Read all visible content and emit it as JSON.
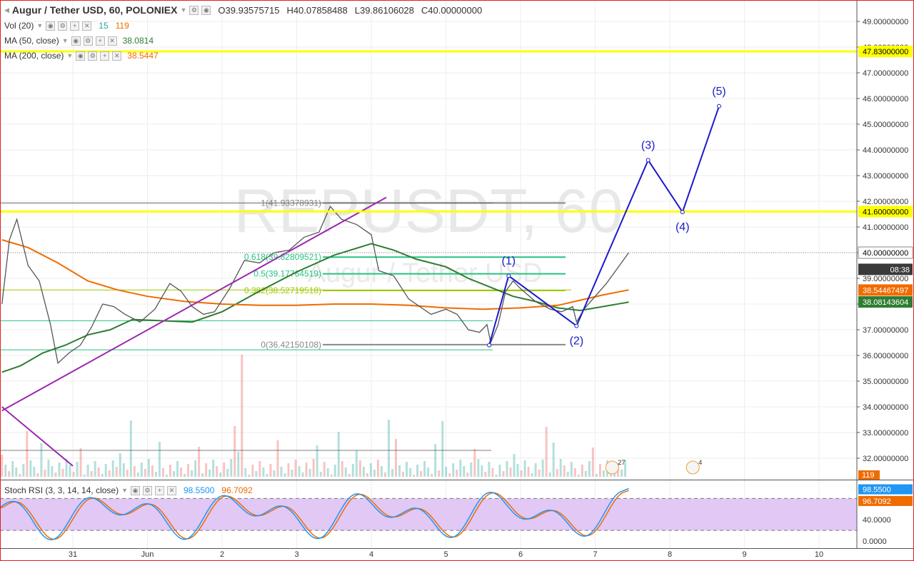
{
  "header": {
    "symbol_title": "Augur / Tether USD, 60, POLONIEX",
    "ohlc": {
      "open": "O39.93575715",
      "high": "H40.07858488",
      "low": "L39.86106028",
      "close": "C40.00000000"
    },
    "indicators": [
      {
        "label": "Vol (20)",
        "values": [
          "15",
          "119"
        ],
        "colors": [
          "#26a69a",
          "#ef6c00"
        ]
      },
      {
        "label": "MA (50, close)",
        "values": [
          "38.0814"
        ],
        "colors": [
          "#2e7d32"
        ]
      },
      {
        "label": "MA (200, close)",
        "values": [
          "38.5447"
        ],
        "colors": [
          "#ef6c00"
        ]
      }
    ],
    "watermark_symbol": "REPUSDT, 60",
    "watermark_name": "Augur / Tether USD"
  },
  "colors": {
    "up": "#26a69a",
    "down": "#ef5350",
    "ma50": "#2e7d32",
    "ma200": "#ef6c00",
    "yellow_line": "#ffff00",
    "wave": "#1a1acc",
    "trend": "#9c27b0",
    "fib_green": "#26c281",
    "fib_olive": "#a0c800",
    "fib_gray": "#888888",
    "rsi_fill": "#e1c8f5",
    "rsi_k": "#2196f3",
    "rsi_d": "#ef6c00"
  },
  "chart_data": {
    "type": "line",
    "price_axis": {
      "range": [
        31.5,
        49.5
      ],
      "ticks": [
        "49.00000000",
        "48.00000000",
        "47.00000000",
        "46.00000000",
        "45.00000000",
        "44.00000000",
        "43.00000000",
        "42.00000000",
        "41.00000000",
        "40.00000000",
        "39.00000000",
        "38.00000000",
        "37.00000000",
        "36.00000000",
        "35.00000000",
        "34.00000000",
        "33.00000000",
        "32.00000000"
      ],
      "tick_values": [
        49,
        48,
        47,
        46,
        45,
        44,
        43,
        42,
        41,
        40,
        39,
        38,
        37,
        36,
        35,
        34,
        33,
        32
      ]
    },
    "price_labels": [
      {
        "value": 47.83,
        "text": "47.83000000",
        "style": "yellow"
      },
      {
        "value": 41.6,
        "text": "41.60000000",
        "style": "yellow"
      },
      {
        "value": 40.0,
        "text": "40.00000000",
        "style": "white"
      },
      {
        "value": 39.35,
        "text": "08:38",
        "style": "dark"
      },
      {
        "value": 38.5447,
        "text": "38.54467497",
        "style": "orange"
      },
      {
        "value": 38.0814,
        "text": "38.08143604",
        "style": "green"
      }
    ],
    "volume_label": "119",
    "x_axis": {
      "labels": [
        "31",
        "Jun",
        "2",
        "3",
        "4",
        "5",
        "6",
        "7",
        "8",
        "9",
        "10"
      ],
      "positions": [
        0.0,
        1.0,
        2.0,
        3.0,
        4.0,
        5.0,
        6.0,
        7.0,
        8.0,
        9.0,
        10.0
      ]
    },
    "horizontal_lines": [
      {
        "value": 47.83,
        "color": "yellow"
      },
      {
        "value": 41.6,
        "color": "yellow"
      }
    ],
    "fibonacci": [
      {
        "level": "1",
        "price": 41.93378931,
        "label": "1(41.93378931)"
      },
      {
        "level": "0.618",
        "price": 39.82809521,
        "label": "0.618(39.82809521)"
      },
      {
        "level": "0.5",
        "price": 39.17764519,
        "label": "0.5(39.17764519)"
      },
      {
        "level": "0.382",
        "price": 38.52719518,
        "label": "0.382(38.52719518)"
      },
      {
        "level": "0",
        "price": 36.42150108,
        "label": "0(36.42150108)"
      }
    ],
    "elliott_waves": [
      {
        "label": "(1)",
        "day": 5.84,
        "price": 39.1
      },
      {
        "label": "(2)",
        "day": 6.75,
        "price": 37.15
      },
      {
        "label": "(3)",
        "day": 7.71,
        "price": 43.6
      },
      {
        "label": "(4)",
        "day": 8.17,
        "price": 41.58
      },
      {
        "label": "(5)",
        "day": 8.66,
        "price": 45.7
      }
    ],
    "elliott_start": {
      "day": 5.58,
      "price": 36.4
    },
    "trend_lines": [
      {
        "from": {
          "day": -0.95,
          "price": 33.85
        },
        "to": {
          "day": 4.2,
          "price": 42.15
        }
      },
      {
        "from": {
          "day": -0.95,
          "price": 34.0
        },
        "to": {
          "day": 0.0,
          "price": 31.7
        }
      }
    ],
    "series": [
      {
        "name": "MA (50, close)",
        "color": "#2e7d32",
        "points": [
          [
            -0.95,
            35.35
          ],
          [
            -0.7,
            35.6
          ],
          [
            -0.4,
            36.1
          ],
          [
            -0.1,
            36.4
          ],
          [
            0.2,
            36.8
          ],
          [
            0.5,
            37.0
          ],
          [
            0.8,
            37.4
          ],
          [
            1.2,
            37.35
          ],
          [
            1.6,
            37.3
          ],
          [
            2.0,
            37.7
          ],
          [
            2.5,
            38.5
          ],
          [
            3.0,
            39.25
          ],
          [
            3.5,
            39.9
          ],
          [
            4.0,
            40.35
          ],
          [
            4.3,
            40.1
          ],
          [
            4.6,
            39.75
          ],
          [
            5.0,
            39.45
          ],
          [
            5.3,
            39.0
          ],
          [
            5.6,
            38.65
          ],
          [
            5.9,
            38.3
          ],
          [
            6.2,
            38.1
          ],
          [
            6.5,
            37.85
          ],
          [
            6.8,
            37.75
          ],
          [
            7.1,
            37.9
          ],
          [
            7.4,
            38.05
          ],
          [
            7.45,
            38.08
          ]
        ]
      },
      {
        "name": "MA (200, close)",
        "color": "#ef6c00",
        "points": [
          [
            -0.95,
            40.5
          ],
          [
            -0.6,
            40.2
          ],
          [
            -0.2,
            39.6
          ],
          [
            0.2,
            38.9
          ],
          [
            0.6,
            38.55
          ],
          [
            1.0,
            38.3
          ],
          [
            1.5,
            38.1
          ],
          [
            2.0,
            38.0
          ],
          [
            2.5,
            37.95
          ],
          [
            3.0,
            37.95
          ],
          [
            3.5,
            38.0
          ],
          [
            4.0,
            38.0
          ],
          [
            4.5,
            37.95
          ],
          [
            5.0,
            37.85
          ],
          [
            5.5,
            37.8
          ],
          [
            6.0,
            37.85
          ],
          [
            6.5,
            37.95
          ],
          [
            6.8,
            38.15
          ],
          [
            7.1,
            38.35
          ],
          [
            7.45,
            38.55
          ]
        ]
      },
      {
        "name": "Price",
        "color": "#555555",
        "points": [
          [
            -0.95,
            38.0
          ],
          [
            -0.85,
            40.5
          ],
          [
            -0.75,
            41.3
          ],
          [
            -0.6,
            39.5
          ],
          [
            -0.45,
            38.9
          ],
          [
            -0.3,
            37.2
          ],
          [
            -0.2,
            35.7
          ],
          [
            -0.05,
            36.1
          ],
          [
            0.1,
            36.4
          ],
          [
            0.25,
            37.1
          ],
          [
            0.4,
            38.0
          ],
          [
            0.55,
            37.9
          ],
          [
            0.7,
            37.6
          ],
          [
            0.9,
            37.3
          ],
          [
            1.1,
            37.8
          ],
          [
            1.3,
            38.8
          ],
          [
            1.45,
            38.5
          ],
          [
            1.6,
            37.9
          ],
          [
            1.75,
            37.6
          ],
          [
            1.9,
            37.7
          ],
          [
            2.1,
            38.6
          ],
          [
            2.3,
            39.7
          ],
          [
            2.5,
            39.6
          ],
          [
            2.7,
            40.0
          ],
          [
            2.9,
            40.1
          ],
          [
            3.1,
            40.6
          ],
          [
            3.3,
            40.8
          ],
          [
            3.45,
            41.8
          ],
          [
            3.6,
            41.3
          ],
          [
            3.8,
            41.1
          ],
          [
            4.0,
            40.7
          ],
          [
            4.1,
            39.3
          ],
          [
            4.3,
            39.1
          ],
          [
            4.5,
            38.2
          ],
          [
            4.65,
            37.9
          ],
          [
            4.8,
            37.6
          ],
          [
            5.0,
            37.8
          ],
          [
            5.15,
            37.6
          ],
          [
            5.3,
            37.0
          ],
          [
            5.45,
            36.9
          ],
          [
            5.55,
            37.2
          ],
          [
            5.6,
            36.5
          ],
          [
            5.7,
            37.2
          ],
          [
            5.8,
            38.5
          ],
          [
            5.9,
            38.9
          ],
          [
            6.0,
            38.6
          ],
          [
            6.2,
            38.1
          ],
          [
            6.4,
            37.8
          ],
          [
            6.55,
            37.7
          ],
          [
            6.7,
            37.9
          ],
          [
            6.75,
            37.3
          ],
          [
            6.85,
            37.8
          ],
          [
            7.0,
            38.3
          ],
          [
            7.15,
            38.8
          ],
          [
            7.3,
            39.4
          ],
          [
            7.45,
            40.0
          ]
        ]
      }
    ]
  },
  "rsi": {
    "label": "Stoch RSI (3, 3, 14, 14, close)",
    "values": [
      "98.5500",
      "96.7092"
    ],
    "ticks": [
      "40.0000",
      "0.0000"
    ],
    "tick_values": [
      40,
      0
    ],
    "range": [
      -8,
      110
    ],
    "band": [
      20,
      80
    ],
    "k_label": "98.5500",
    "d_label": "96.7092"
  },
  "events": [
    {
      "text": "27",
      "day": 6.75
    },
    {
      "text": "4",
      "day": 7.83
    }
  ]
}
